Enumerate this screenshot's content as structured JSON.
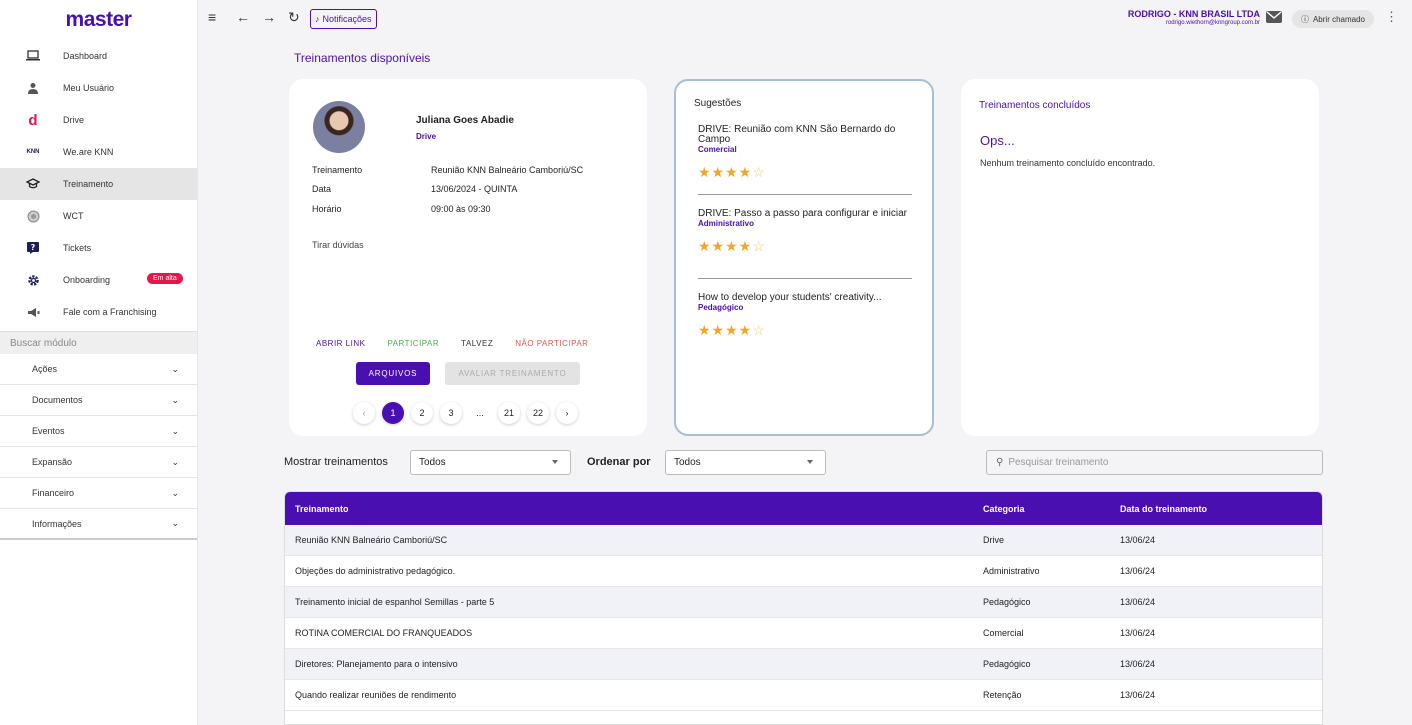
{
  "brand": "master",
  "nav": [
    {
      "label": "Dashboard",
      "icon": "laptop-icon"
    },
    {
      "label": "Meu Usuário",
      "icon": "user-icon"
    },
    {
      "label": "Drive",
      "icon": "drive-icon"
    },
    {
      "label": "We.are KNN",
      "icon": "knn-icon"
    },
    {
      "label": "Treinamento",
      "icon": "graduation-icon"
    },
    {
      "label": "WCT",
      "icon": "globe-icon"
    },
    {
      "label": "Tickets",
      "icon": "ticket-icon"
    },
    {
      "label": "Onboarding",
      "icon": "gear-icon",
      "badge": "Em alta"
    },
    {
      "label": "Fale com a Franchising",
      "icon": "megaphone-icon"
    }
  ],
  "search_module_placeholder": "Buscar módulo",
  "accordion": [
    "Ações",
    "Documentos",
    "Eventos",
    "Expansão",
    "Financeiro",
    "Informações"
  ],
  "topbar": {
    "notifications_label": "Notificações",
    "user_name": "RODRIGO - KNN BRASIL LTDA",
    "user_email": "rodrigo.wiethorn@knngroup.com.br",
    "chamado_label": "Abrir chamado"
  },
  "section_title": "Treinamentos disponíveis",
  "training_card": {
    "instructor_name": "Juliana Goes Abadie",
    "instructor_category": "Drive",
    "rows": [
      {
        "label": "Treinamento",
        "value": "Reunião KNN Balneário Camboriú/SC"
      },
      {
        "label": "Data",
        "value": "13/06/2024 - QUINTA"
      },
      {
        "label": "Horário",
        "value": "09:00 às 09:30"
      }
    ],
    "tirar_duvidas": "Tirar dúvidas",
    "actions": {
      "abrir": "ABRIR LINK",
      "participar": "PARTICIPAR",
      "talvez": "TALVEZ",
      "nao": "NÃO PARTICIPAR"
    },
    "arquivos_label": "ARQUIVOS",
    "avaliar_label": "AVALIAR TREINAMENTO",
    "pages": [
      "1",
      "2",
      "3",
      "...",
      "21",
      "22"
    ]
  },
  "suggestions": {
    "title": "Sugestões",
    "items": [
      {
        "name": "DRIVE: Reunião com KNN São Bernardo do Campo",
        "category": "Comercial",
        "rating": 4.5
      },
      {
        "name": "DRIVE: Passo a passo para configurar e iniciar",
        "category": "Administrativo",
        "rating": 4.5
      },
      {
        "name": "How to develop your students' creativity...",
        "category": "Pedagógico",
        "rating": 4.5
      }
    ]
  },
  "completed": {
    "title": "Treinamentos concluídos",
    "ops": "Ops...",
    "message": "Nenhum treinamento concluído encontrado."
  },
  "filters": {
    "show_label": "Mostrar treinamentos",
    "show_value": "Todos",
    "order_label": "Ordenar por",
    "order_value": "Todos",
    "search_placeholder": "Pesquisar treinamento"
  },
  "table": {
    "headers": {
      "name": "Treinamento",
      "category": "Categoria",
      "date": "Data do treinamento"
    },
    "rows": [
      {
        "name": "Reunião KNN Balneário Camboriú/SC",
        "category": "Drive",
        "date": "13/06/24"
      },
      {
        "name": "Objeções do administrativo pedagógico.",
        "category": "Administrativo",
        "date": "13/06/24"
      },
      {
        "name": "Treinamento inicial de espanhol Semillas - parte 5",
        "category": "Pedagógico",
        "date": "13/06/24"
      },
      {
        "name": "ROTINA COMERCIAL DO FRANQUEADOS",
        "category": "Comercial",
        "date": "13/06/24"
      },
      {
        "name": "Diretores: Planejamento para o intensivo",
        "category": "Pedagógico",
        "date": "13/06/24"
      },
      {
        "name": "Quando realizar reuniões de rendimento",
        "category": "Retenção",
        "date": "13/06/24"
      }
    ]
  },
  "colors": {
    "primary": "#4a0fb0",
    "participar": "#4caf50",
    "nao_participar": "#e5574a",
    "badge": "#e5174a",
    "star": "#f5a623"
  }
}
